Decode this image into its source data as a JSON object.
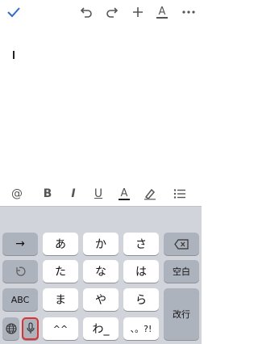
{
  "toolbar": {
    "done_icon": "checkmark-icon",
    "undo_icon": "undo-icon",
    "redo_icon": "redo-icon",
    "add_icon": "plus-icon",
    "format_icon": "text-format-icon",
    "format_label": "A",
    "more_icon": "more-dots-icon",
    "accent_color": "#2f6ad9"
  },
  "editor": {
    "text": "",
    "caret_visible": true
  },
  "format_bar": {
    "mention_label": "@",
    "bold_label": "B",
    "italic_label": "I",
    "underline_label": "U",
    "text_color_label": "A",
    "highlight_icon": "highlighter-icon",
    "list_icon": "bulleted-list-icon"
  },
  "keyboard": {
    "arrow_label": "→",
    "undo_icon": "undo-key-icon",
    "mode_label": "ABC",
    "globe_icon": "globe-icon",
    "mic_icon": "microphone-icon",
    "rows": [
      [
        "あ",
        "か",
        "さ"
      ],
      [
        "た",
        "な",
        "は"
      ],
      [
        "ま",
        "や",
        "ら"
      ],
      [
        "^^",
        "わ_",
        "、。?!"
      ]
    ],
    "backspace_icon": "backspace-icon",
    "space_label": "空白",
    "return_label": "改行",
    "highlight_color": "#e03131"
  }
}
